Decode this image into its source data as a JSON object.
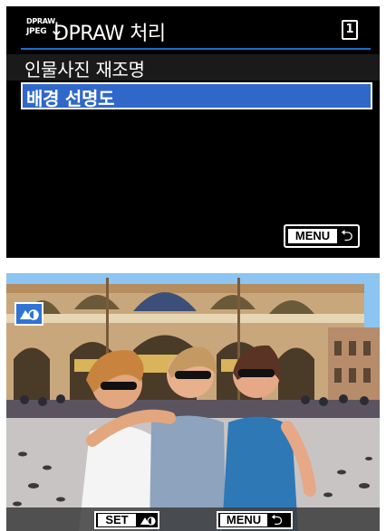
{
  "menu": {
    "icon_line1": "DPRAW",
    "icon_line2": "JPEG",
    "title": "DPRAW 처리",
    "tab_number": "1",
    "items": [
      {
        "label": "인물사진 재조명",
        "selected": false
      },
      {
        "label": "배경 선명도",
        "selected": true
      }
    ],
    "back_button_label": "MENU"
  },
  "preview": {
    "set_button_label": "SET",
    "menu_button_label": "MENU",
    "mode_icon": "background-clarity-icon"
  },
  "colors": {
    "highlight": "#2f68c8",
    "header_line": "#1e6ec8",
    "screen_bg": "#000000"
  }
}
